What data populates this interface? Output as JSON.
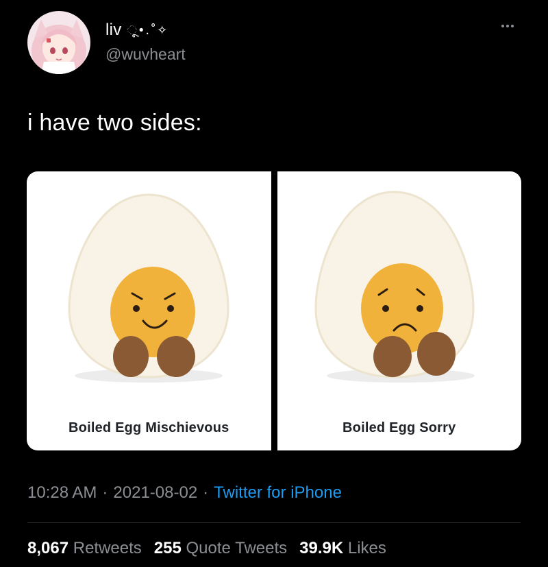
{
  "author": {
    "display_name": "liv",
    "name_decoration": "ૂ•.˚✧",
    "handle": "@wuvheart"
  },
  "tweet": {
    "text": "i have two sides:",
    "time": "10:28 AM",
    "separator": "·",
    "date": "2021-08-02",
    "source": "Twitter for iPhone"
  },
  "media": [
    {
      "caption": "Boiled Egg Mischievous",
      "expression": "mischievous"
    },
    {
      "caption": "Boiled Egg Sorry",
      "expression": "sorry"
    }
  ],
  "stats": {
    "retweets_count": "8,067",
    "retweets_label": "Retweets",
    "quotes_count": "255",
    "quotes_label": "Quote Tweets",
    "likes_count": "39.9K",
    "likes_label": "Likes"
  },
  "icons": {
    "more": "more-horizontal-icon"
  },
  "colors": {
    "background": "#000000",
    "link": "#1d9bf0",
    "muted": "#8b8f93",
    "yolk": "#f0b23a",
    "feet": "#8a5a34"
  }
}
